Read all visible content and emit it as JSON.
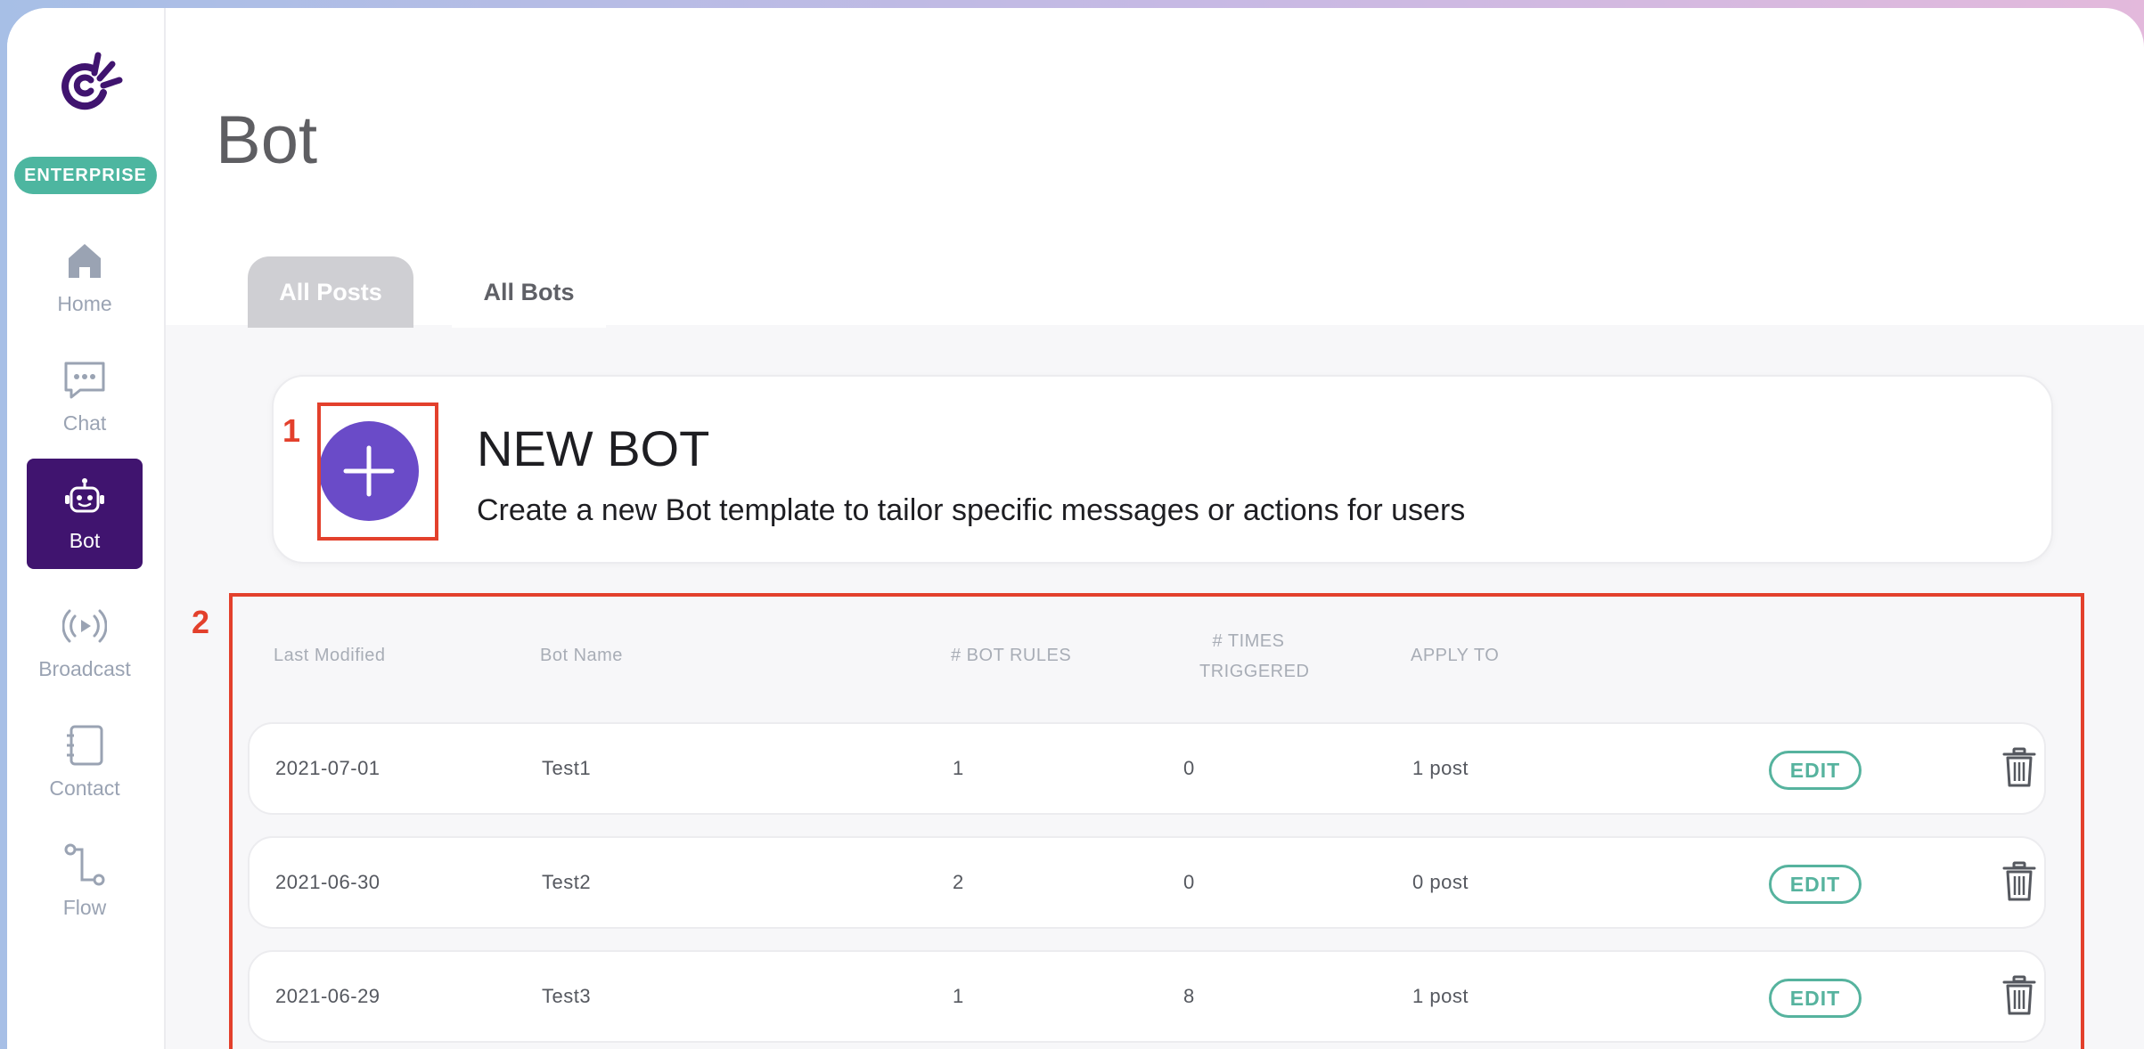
{
  "sidebar": {
    "badge": "ENTERPRISE",
    "items": [
      {
        "label": "Home",
        "icon": "home-icon"
      },
      {
        "label": "Chat",
        "icon": "chat-icon"
      },
      {
        "label": "Bot",
        "icon": "bot-icon",
        "active": true
      },
      {
        "label": "Broadcast",
        "icon": "broadcast-icon"
      },
      {
        "label": "Contact",
        "icon": "contact-icon"
      },
      {
        "label": "Flow",
        "icon": "flow-icon"
      }
    ]
  },
  "page": {
    "title": "Bot",
    "tabs": [
      {
        "label": "All Posts",
        "active": false
      },
      {
        "label": "All Bots",
        "active": true
      }
    ]
  },
  "new_bot": {
    "title": "NEW BOT",
    "description": "Create a new Bot template to tailor specific messages or actions for users"
  },
  "markers": [
    "1",
    "2"
  ],
  "table": {
    "headers": {
      "last_modified": "Last Modified",
      "bot_name": "Bot Name",
      "bot_rules": "# BOT RULES",
      "times_triggered_1": "# TIMES",
      "times_triggered_2": "TRIGGERED",
      "apply_to": "APPLY TO"
    },
    "edit_label": "EDIT",
    "rows": [
      {
        "date": "2021-07-01",
        "name": "Test1",
        "rules": "1",
        "triggered": "0",
        "apply": "1 post"
      },
      {
        "date": "2021-06-30",
        "name": "Test2",
        "rules": "2",
        "triggered": "0",
        "apply": "0 post"
      },
      {
        "date": "2021-06-29",
        "name": "Test3",
        "rules": "1",
        "triggered": "8",
        "apply": "1 post"
      }
    ]
  },
  "colors": {
    "brand_purple": "#40146f",
    "add_button": "#6a4bc8",
    "accent_green": "#4db6a0",
    "marker_red": "#e3402c"
  }
}
